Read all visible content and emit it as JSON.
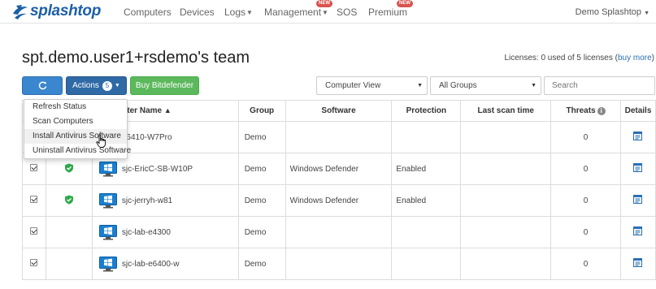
{
  "brand": {
    "name": "splashtop",
    "color": "#1c5fa8"
  },
  "nav": {
    "items": [
      {
        "label": "Computers",
        "caret": false,
        "new": false
      },
      {
        "label": "Devices",
        "caret": false,
        "new": false
      },
      {
        "label": "Logs",
        "caret": true,
        "new": false
      },
      {
        "label": "Management",
        "caret": true,
        "new": true
      },
      {
        "label": "SOS",
        "caret": false,
        "new": false
      },
      {
        "label": "Premium",
        "caret": false,
        "new": true
      }
    ],
    "new_badge": "NEW",
    "user": "Demo Splashtop"
  },
  "page": {
    "title": "spt.demo.user1+rsdemo's team",
    "licenses_text": "Licenses: 0 used of 5 licenses (",
    "licenses_link": "buy more",
    "licenses_close": ")"
  },
  "toolbar": {
    "refresh_icon": "refresh-icon",
    "actions_label": "Actions",
    "actions_count": "5",
    "buy_label": "Buy Bitdefender",
    "view_select": "Computer View",
    "group_select": "All Groups",
    "search_placeholder": "Search"
  },
  "actions_menu": {
    "items": [
      "Refresh Status",
      "Scan Computers",
      "Install Antivirus Software",
      "Uninstall Antivirus Software"
    ],
    "hovered_index": 2
  },
  "table": {
    "headers": {
      "computer_name": "Computer Name",
      "group": "Group",
      "software": "Software",
      "protection": "Protection",
      "last_scan": "Last scan time",
      "threats": "Threats",
      "details": "Details"
    },
    "rows": [
      {
        "checked": true,
        "protected": false,
        "name": "e6410-W7Pro",
        "group": "Demo",
        "software": "",
        "protection": "",
        "last_scan": "",
        "threats": "0"
      },
      {
        "checked": true,
        "protected": true,
        "name": "sjc-EricC-SB-W10P",
        "group": "Demo",
        "software": "Windows Defender",
        "protection": "Enabled",
        "last_scan": "",
        "threats": "0"
      },
      {
        "checked": true,
        "protected": true,
        "name": "sjc-jerryh-w81",
        "group": "Demo",
        "software": "Windows Defender",
        "protection": "Enabled",
        "last_scan": "",
        "threats": "0"
      },
      {
        "checked": true,
        "protected": false,
        "name": "sjc-lab-e4300",
        "group": "Demo",
        "software": "",
        "protection": "",
        "last_scan": "",
        "threats": "0"
      },
      {
        "checked": true,
        "protected": false,
        "name": "sjc-lab-e6400-w",
        "group": "Demo",
        "software": "",
        "protection": "",
        "last_scan": "",
        "threats": "0"
      }
    ]
  },
  "colors": {
    "primary": "#2f6aa6",
    "refresh": "#3a86cf",
    "success": "#5cb85c",
    "shield": "#2eaa4a",
    "link": "#2a6fb5"
  }
}
